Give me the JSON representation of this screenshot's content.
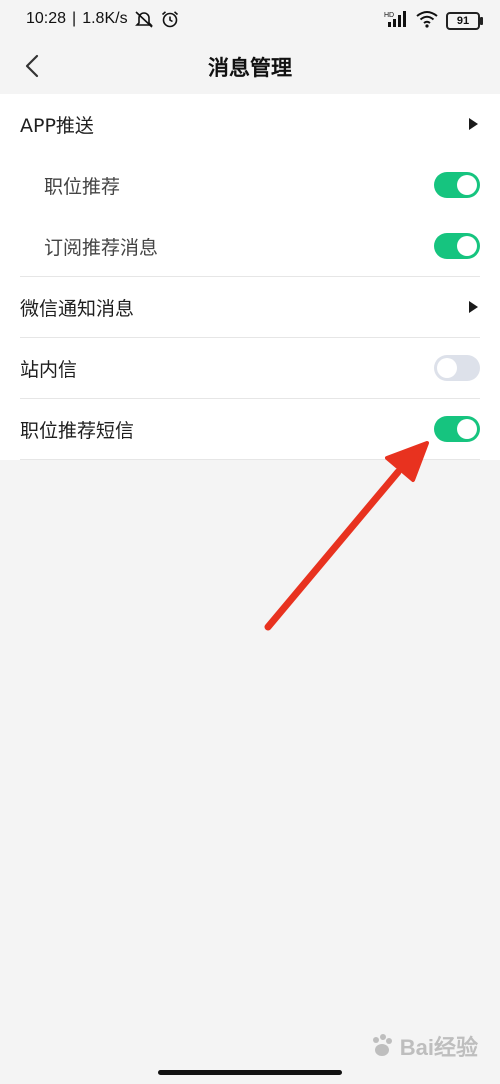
{
  "status_bar": {
    "time": "10:28",
    "separator": "|",
    "speed": "1.8K/s",
    "battery": "91"
  },
  "header": {
    "title": "消息管理"
  },
  "settings": [
    {
      "label": "APP推送",
      "control": "arrow"
    },
    {
      "label": "职位推荐",
      "control": "toggle",
      "enabled": true
    },
    {
      "label": "订阅推荐消息",
      "control": "toggle",
      "enabled": true
    },
    {
      "label": "微信通知消息",
      "control": "arrow"
    },
    {
      "label": "站内信",
      "control": "toggle",
      "enabled": false
    },
    {
      "label": "职位推荐短信",
      "control": "toggle",
      "enabled": true
    }
  ],
  "colors": {
    "toggle_on": "#16c47f",
    "toggle_off": "#dde1ea",
    "annotation_arrow": "#e8321f"
  },
  "watermark": {
    "text": "Bai经验"
  }
}
